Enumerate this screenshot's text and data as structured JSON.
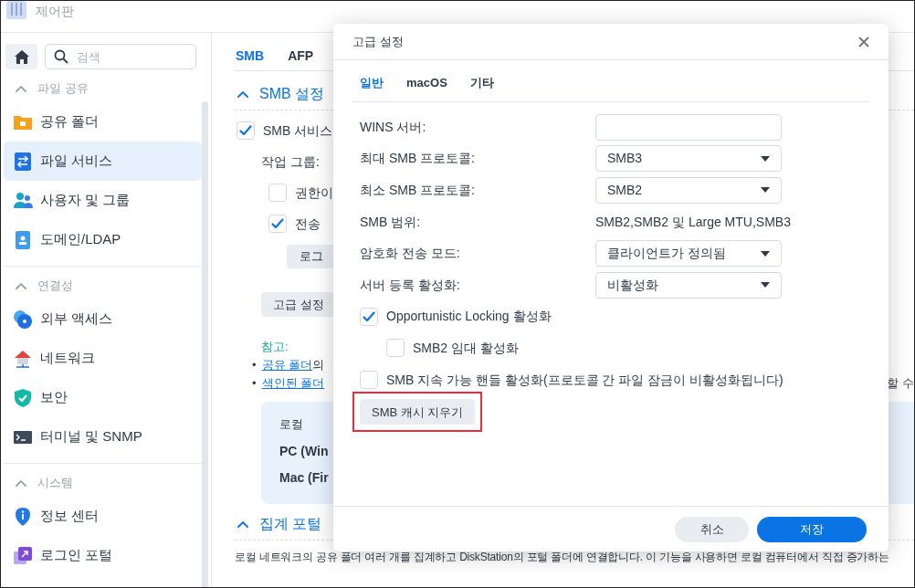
{
  "app": {
    "title": "제어판"
  },
  "sidebar": {
    "search": {
      "placeholder": "검색"
    },
    "sections": [
      {
        "title": "파일 공유",
        "expanded": true,
        "items": [
          {
            "label": "공유 폴더",
            "selected": false
          },
          {
            "label": "파일 서비스",
            "selected": true
          },
          {
            "label": "사용자 및 그룹",
            "selected": false
          },
          {
            "label": "도메인/LDAP",
            "selected": false
          }
        ]
      },
      {
        "title": "연결성",
        "expanded": true,
        "items": [
          {
            "label": "외부 액세스",
            "selected": false
          },
          {
            "label": "네트워크",
            "selected": false
          },
          {
            "label": "보안",
            "selected": false
          },
          {
            "label": "터미널 및 SNMP",
            "selected": false
          }
        ]
      },
      {
        "title": "시스템",
        "expanded": true,
        "items": [
          {
            "label": "정보 센터",
            "selected": false
          },
          {
            "label": "로그인 포털",
            "selected": false
          }
        ]
      }
    ]
  },
  "main": {
    "tabs": [
      {
        "label": "SMB",
        "selected": true
      },
      {
        "label": "AFP",
        "selected": false
      }
    ],
    "smb_section": {
      "title": "SMB 설정",
      "expanded": true,
      "enable": {
        "label": "SMB 서비스",
        "checked": true
      },
      "workgroup_label": "작업 그룹:",
      "options": [
        {
          "label": "권한이",
          "checked": false
        },
        {
          "label": "전송",
          "checked": true
        }
      ],
      "log_button": "로그",
      "advanced_button": "고급 설정",
      "note_title": "참고:",
      "notes": [
        {
          "bullet": "•",
          "link": "공유 폴더",
          "text": "의"
        },
        {
          "bullet": "•",
          "link": "색인된 폴더"
        }
      ],
      "right_fragment": "할 수",
      "info_box": {
        "text": "로컬",
        "bold_lines": [
          "PC (Win",
          "Mac (Fir"
        ]
      }
    },
    "portal_section": {
      "title": "집계 포털",
      "expanded": true,
      "description": "로컬 네트워크의 공유 폴더 여러 개를 집계하고 DiskStation의 포털 폴더에 연결합니다. 이 기능을 사용하면 로컬 컴퓨터에서 직접 증가하는"
    }
  },
  "dialog": {
    "title": "고급 설정",
    "tabs": [
      {
        "label": "일반",
        "selected": true
      },
      {
        "label": "macOS",
        "selected": false
      },
      {
        "label": "기타",
        "selected": false
      }
    ],
    "fields": [
      {
        "kind": "input",
        "label": "WINS 서버:"
      },
      {
        "kind": "select",
        "label": "최대 SMB 프로토콜:",
        "value": "SMB3"
      },
      {
        "kind": "select",
        "label": "최소 SMB 프로토콜:",
        "value": "SMB2"
      },
      {
        "kind": "text",
        "label": "SMB 범위:",
        "value": "SMB2,SMB2 및 Large MTU,SMB3"
      },
      {
        "kind": "select",
        "label": "암호화 전송 모드:",
        "value": "클라이언트가 정의됨"
      },
      {
        "kind": "select",
        "label": "서버 등록 활성화:",
        "value": "비활성화"
      }
    ],
    "checkboxes": [
      {
        "label": "Opportunistic Locking 활성화",
        "checked": true,
        "children": [
          {
            "label": "SMB2 임대 활성화",
            "checked": false
          }
        ]
      },
      {
        "label": "SMB 지속 가능 핸들 활성화(프로토콜 간 파일 잠금이 비활성화됩니다)",
        "checked": false
      }
    ],
    "clear_cache_button": {
      "label": "SMB 캐시 지우기",
      "highlighted": true
    },
    "buttons": [
      {
        "label": "취소",
        "kind": "secondary"
      },
      {
        "label": "저장",
        "kind": "primary"
      }
    ]
  }
}
